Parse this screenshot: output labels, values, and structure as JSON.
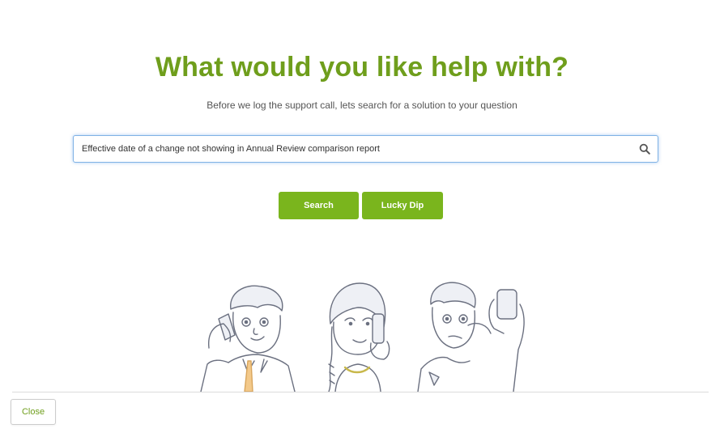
{
  "header": {
    "title": "What would you like help with?",
    "subtitle": "Before we log the support call, lets search for a solution to your question"
  },
  "search": {
    "value": "Effective date of a change not showing in Annual Review comparison report",
    "icon": "search-icon"
  },
  "actions": {
    "search_label": "Search",
    "lucky_label": "Lucky Dip"
  },
  "footer": {
    "close_label": "Close"
  },
  "colors": {
    "title": "#6f9e1c",
    "button": "#7ab51d",
    "focus_border": "#7fb2e5"
  }
}
